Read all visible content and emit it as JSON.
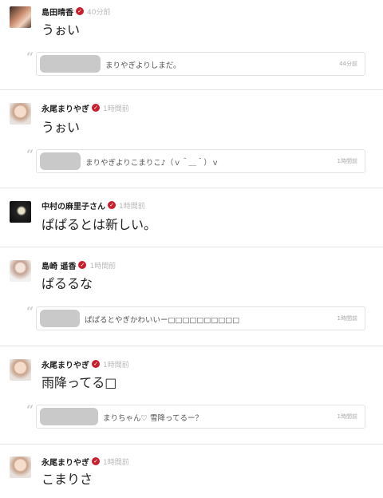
{
  "posts": [
    {
      "name": "島田晴香",
      "time": "40分前",
      "message": "うぉい",
      "quote": {
        "text": "まりやぎよりしまだ。",
        "time": "44分前"
      }
    },
    {
      "name": "永尾まりやぎ",
      "time": "1時間前",
      "message": "うぉい",
      "quote": {
        "text": "まりやぎよりこまりこ♪（ｖ＾＿＾）ｖ",
        "time": "1時間前"
      }
    },
    {
      "name": "中村の麻里子さん",
      "time": "1時間前",
      "message": "ぱぱるとは新しい。"
    },
    {
      "name": "島崎 遥香",
      "time": "1時間前",
      "message": "ぱるるな",
      "quote": {
        "text": "ぱぱるとやぎかわいいー□□□□□□□□□□",
        "time": "1時間前"
      }
    },
    {
      "name": "永尾まりやぎ",
      "time": "1時間前",
      "message": "雨降ってる□",
      "quote": {
        "text": "まりちゃん♡ 雪降ってるー？",
        "time": "1時間前"
      }
    },
    {
      "name": "永尾まりやぎ",
      "time": "1時間前",
      "message": "こまりさ"
    }
  ],
  "verified_badge_color": "#c81e2e",
  "verified_badge_icon": "check-badge-icon"
}
